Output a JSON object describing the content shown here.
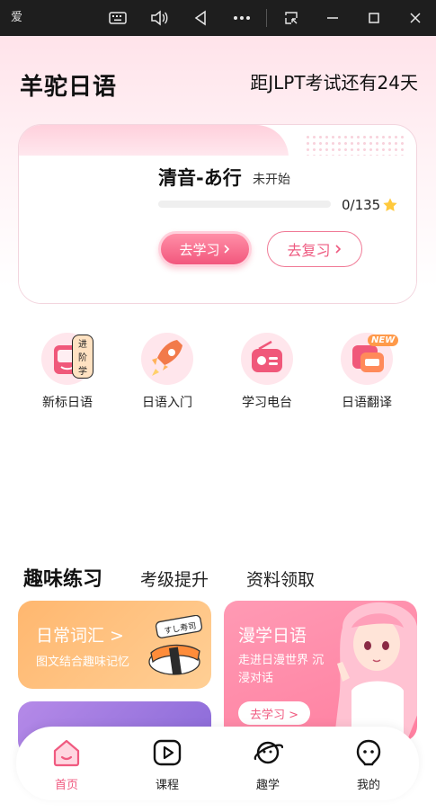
{
  "system_bar": {
    "app_label": "爱"
  },
  "header": {
    "title": "羊驼日语",
    "countdown": "距JLPT考试还有24天"
  },
  "lesson_card": {
    "title": "清音-あ行",
    "status": "未开始",
    "progress_text": "0/135",
    "progress_fraction": 0,
    "study_button": "去学习",
    "review_button": "去复习"
  },
  "quick_entries": [
    {
      "label": "新标日语",
      "badge": "进阶学",
      "icon": "book-icon"
    },
    {
      "label": "日语入门",
      "badge": "",
      "icon": "rocket-icon"
    },
    {
      "label": "学习电台",
      "badge": "",
      "icon": "radio-icon"
    },
    {
      "label": "日语翻译",
      "badge": "NEW",
      "icon": "translate-icon"
    }
  ],
  "tabs": [
    {
      "label": "趣味练习",
      "active": true
    },
    {
      "label": "考级提升",
      "active": false
    },
    {
      "label": "资料领取",
      "active": false
    }
  ],
  "practice": {
    "vocab": {
      "title": "日常词汇 >",
      "subtitle": "图文结合趣味记忆",
      "sticker": "すし寿司"
    },
    "manga": {
      "title": "漫学日语",
      "subtitle": "走进日漫世界 沉浸对话",
      "button": "去学习 >"
    }
  },
  "bottom_nav": [
    {
      "label": "首页",
      "icon": "home-icon",
      "active": true
    },
    {
      "label": "课程",
      "icon": "play-icon",
      "active": false
    },
    {
      "label": "趣学",
      "icon": "planet-icon",
      "active": false
    },
    {
      "label": "我的",
      "icon": "face-icon",
      "active": false
    }
  ],
  "colors": {
    "accent": "#f05a80",
    "vocab_card": "#ffb76f",
    "manga_card": "#ff8fab"
  }
}
